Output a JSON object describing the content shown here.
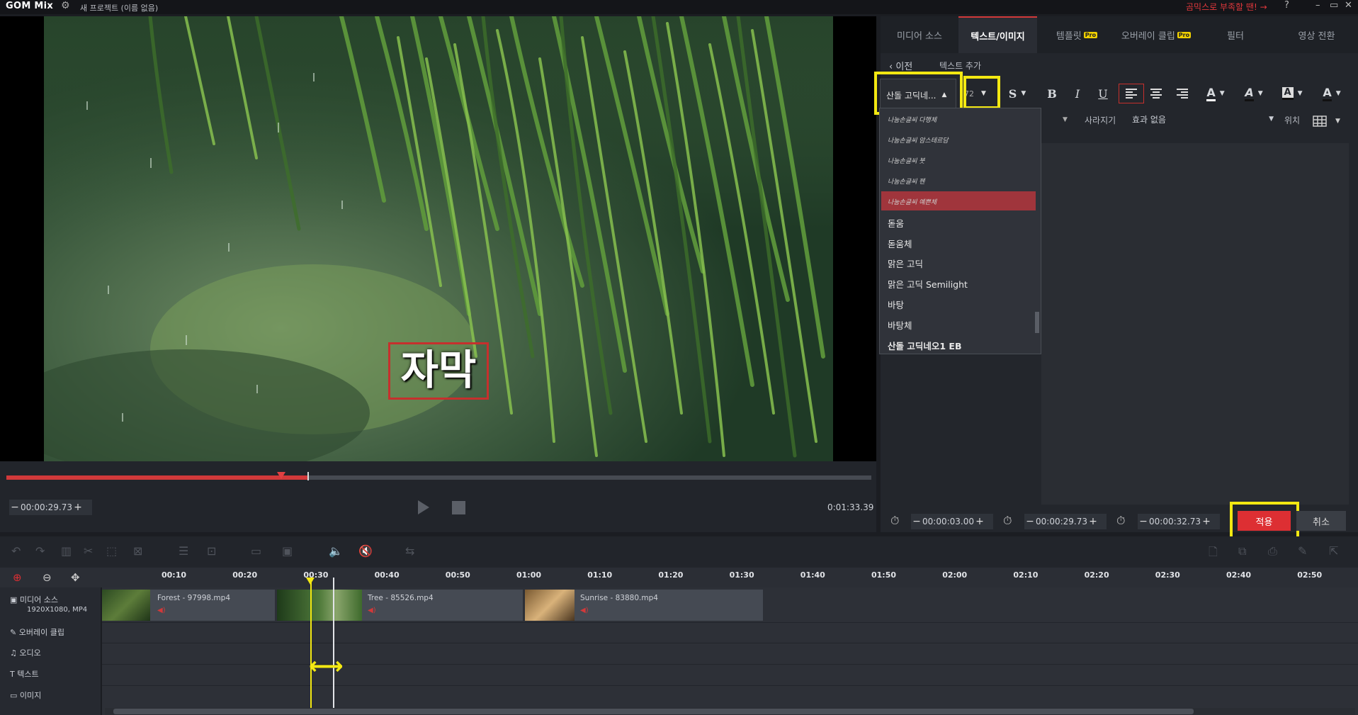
{
  "app": {
    "logo": "GOM Mix",
    "project_title": "새 프로젝트 (이름 없음)",
    "promo": "곰믹스로 부족할 땐! →",
    "help": "?",
    "window_buttons": [
      "–",
      "▭",
      "✕"
    ]
  },
  "preview": {
    "subtitle_text": "자막",
    "current_time": "00:00:29.73",
    "total_time": "0:01:33.39",
    "progress_fraction": 0.35
  },
  "panel": {
    "tabs": [
      {
        "label": "미디어 소스",
        "active": false,
        "pro": false
      },
      {
        "label": "텍스트/이미지",
        "active": true,
        "pro": false
      },
      {
        "label": "템플릿",
        "active": false,
        "pro": true
      },
      {
        "label": "오버레이 클립",
        "active": false,
        "pro": true
      },
      {
        "label": "필터",
        "active": false,
        "pro": false
      },
      {
        "label": "영상 전환",
        "active": false,
        "pro": false
      }
    ],
    "pro_badge": "Pro",
    "back_label": "이전",
    "section_title": "텍스트 추가",
    "font_selected": "산돌 고딕네...",
    "font_size": "72",
    "toolbar": {
      "shadow": "S",
      "bold": "B",
      "italic": "I",
      "underline": "U",
      "font_color": "A",
      "outline_color": "A",
      "bg_color": "A",
      "text_color2": "A"
    },
    "row2": {
      "disappear_label": "사라지기",
      "effect_value": "효과 없음",
      "position_label": "위치"
    },
    "font_list": [
      {
        "name": "나눔손글씨 다행체",
        "script": true
      },
      {
        "name": "나눔손글씨 암스테르담",
        "script": true
      },
      {
        "name": "나눔손글씨 붓",
        "script": true
      },
      {
        "name": "나눔손글씨 펜",
        "script": true
      },
      {
        "name": "나눔손글씨 예쁜체",
        "script": true
      },
      {
        "name": "돋움",
        "script": false
      },
      {
        "name": "돋움체",
        "script": false
      },
      {
        "name": "맑은 고딕",
        "script": false
      },
      {
        "name": "맑은 고딕 Semilight",
        "script": false
      },
      {
        "name": "바탕",
        "script": false
      },
      {
        "name": "바탕체",
        "script": false
      },
      {
        "name": "산돌 고딕네오1 EB",
        "script": false
      }
    ],
    "timing": {
      "duration": "00:00:03.00",
      "start": "00:00:29.73",
      "end": "00:00:32.73"
    },
    "apply_label": "적용",
    "cancel_label": "취소"
  },
  "timeline": {
    "ticks": [
      "00:10",
      "00:20",
      "00:30",
      "00:40",
      "00:50",
      "01:00",
      "01:10",
      "01:20",
      "01:30",
      "01:40",
      "01:50",
      "02:00",
      "02:10",
      "02:20",
      "02:30",
      "02:40",
      "02:50"
    ],
    "tracks": {
      "media": "미디어 소스",
      "media_info": "1920X1080, MP4",
      "overlay": "오버레이 클립",
      "audio": "오디오",
      "text": "텍스트",
      "image": "이미지"
    },
    "clips": [
      {
        "name": "Forest - 97998.mp4"
      },
      {
        "name": "Tree - 85526.mp4"
      },
      {
        "name": "Sunrise - 83880.mp4"
      }
    ]
  },
  "colors": {
    "accent": "#d2393a",
    "highlight": "#f3e812",
    "panel_bg": "#23262c",
    "selection": "#a0353c"
  }
}
